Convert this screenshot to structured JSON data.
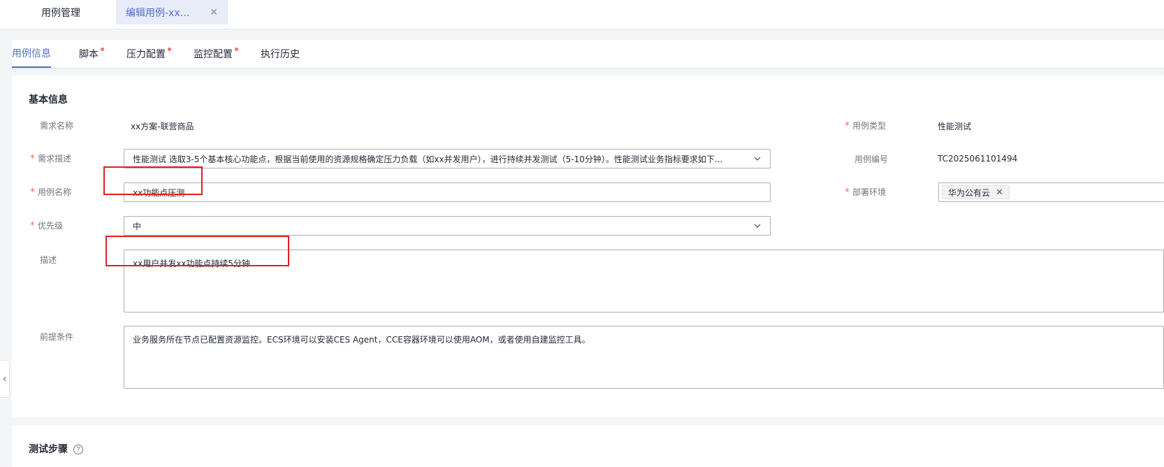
{
  "page_tabs": [
    {
      "label": "用例管理"
    },
    {
      "label": "编辑用例-xx功..."
    }
  ],
  "content_tabs": [
    {
      "label": "用例信息",
      "active": true
    },
    {
      "label": "脚本",
      "dot": true
    },
    {
      "label": "压力配置",
      "dot": true
    },
    {
      "label": "监控配置",
      "dot": true
    },
    {
      "label": "执行历史"
    }
  ],
  "basic_info": {
    "title": "基本信息",
    "requirement_name_label": "需求名称",
    "requirement_name_value": "xx方案-联营商品",
    "requirement_desc_label": "需求描述",
    "requirement_desc_value": "性能测试 选取3-5个基本核心功能点，根据当前使用的资源规格确定压力负载（如xx并发用户），进行持续并发测试（5-10分钟）。性能测试业务指标要求如下...",
    "case_name_label": "用例名称",
    "case_name_value": "xx功能点压测",
    "priority_label": "优先级",
    "priority_value": "中",
    "description_label": "描述",
    "description_value": "xx用户并发xx功能点持续5分钟",
    "precondition_label": "前提条件",
    "precondition_value": "业务服务所在节点已配置资源监控。ECS环境可以安装CES Agent，CCE容器环境可以使用AOM，或者使用自建监控工具。",
    "case_type_label": "用例类型",
    "case_type_value": "性能测试",
    "case_no_label": "用例编号",
    "case_no_value": "TC2025061101494",
    "deploy_env_label": "部署环境",
    "deploy_env_tag": "华为公有云",
    "required_mark": "*"
  },
  "test_steps": {
    "title": "测试步骤",
    "help_glyph": "?"
  },
  "icons": {
    "close": "✕",
    "chevron_left": "‹"
  },
  "colors": {
    "accent": "#526ecc",
    "required": "#f66f6a",
    "highlight": "#e02020"
  }
}
